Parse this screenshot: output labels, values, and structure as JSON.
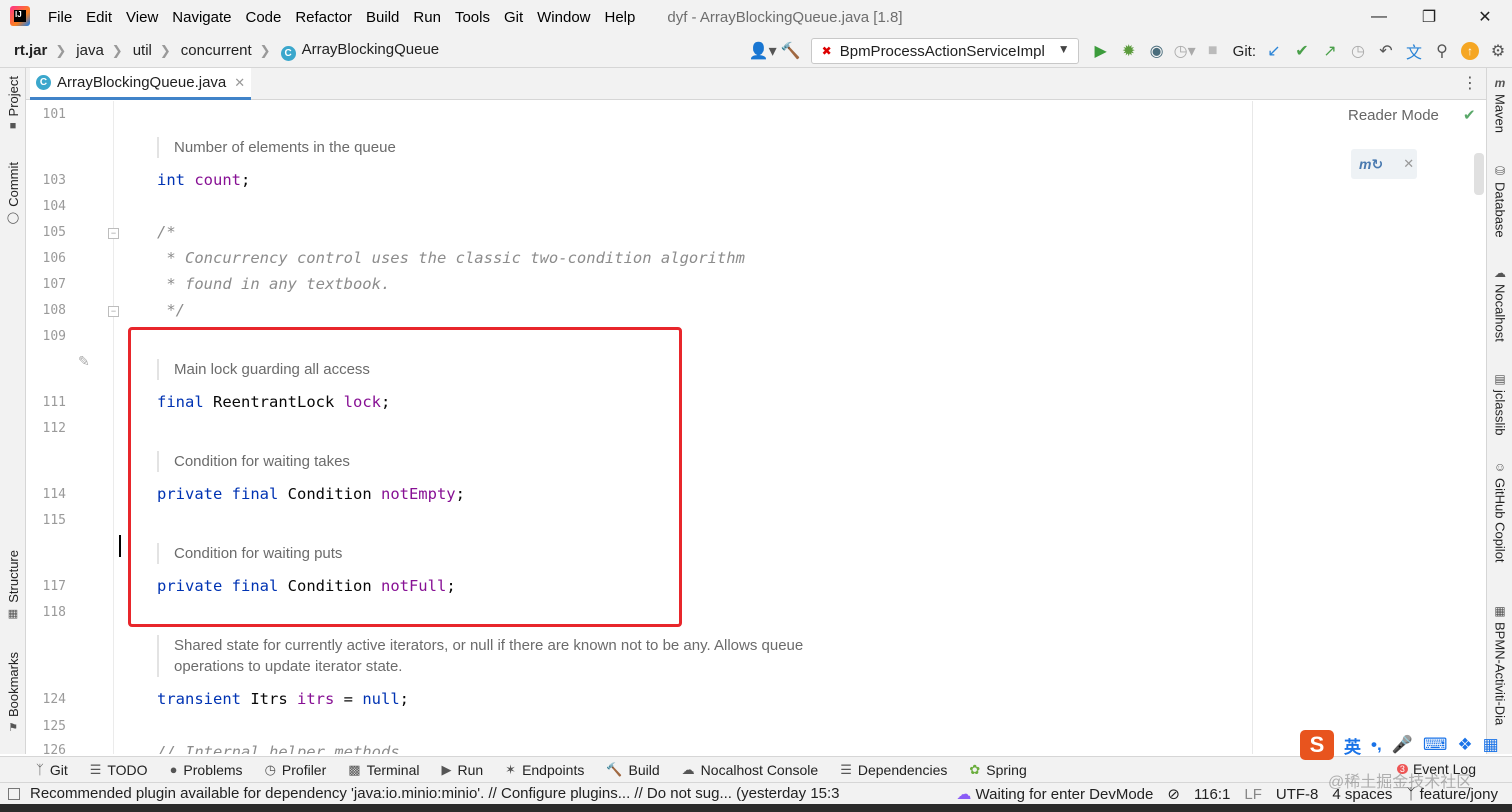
{
  "menubar": {
    "items": [
      "File",
      "Edit",
      "View",
      "Navigate",
      "Code",
      "Refactor",
      "Build",
      "Run",
      "Tools",
      "Git",
      "Window",
      "Help"
    ],
    "title": "dyf - ArrayBlockingQueue.java [1.8]"
  },
  "navbar": {
    "crumbs": [
      "rt.jar",
      "java",
      "util",
      "concurrent",
      "ArrayBlockingQueue"
    ],
    "run_config": "BpmProcessActionServiceImpl",
    "git_label": "Git:"
  },
  "tab": {
    "label": "ArrayBlockingQueue.java"
  },
  "left_tools": [
    "Project",
    "Commit",
    "Structure",
    "Bookmarks"
  ],
  "right_tools": [
    "Maven",
    "Database",
    "Nocalhost",
    "jclasslib",
    "GitHub Copilot",
    "BPMN-Activiti-Dia"
  ],
  "editor": {
    "reader_mode": "Reader Mode",
    "lines": [
      "101",
      "103",
      "104",
      "105",
      "106",
      "107",
      "108",
      "109",
      "111",
      "112",
      "114",
      "115",
      "117",
      "118",
      "124",
      "125",
      "126"
    ],
    "doc_count": "Number of elements in the queue",
    "code_count": {
      "kw": "int",
      "name": "count",
      "end": ";"
    },
    "comment_1": "/*",
    "comment_2": " * Concurrency control uses the classic two-condition algorithm",
    "comment_3": " * found in any textbook.",
    "comment_4": " */",
    "doc_lock": "Main lock guarding all access",
    "code_lock": {
      "kw": "final",
      "type": " ReentrantLock ",
      "name": "lock",
      "end": ";"
    },
    "doc_notempty": "Condition for waiting takes",
    "code_notempty": {
      "kw": "private final",
      "type": " Condition ",
      "name": "notEmpty",
      "end": ";"
    },
    "doc_notfull": "Condition for waiting puts",
    "code_notfull": {
      "kw": "private final",
      "type": " Condition ",
      "name": "notFull",
      "end": ";"
    },
    "doc_itrs_1": "Shared state for currently active iterators, or null if there are known not to be any. Allows queue",
    "doc_itrs_2": "operations to update iterator state.",
    "code_itrs": {
      "kw": "transient",
      "type": " Itrs ",
      "name": "itrs",
      "mid": " = ",
      "kw2": "null",
      "end": ";"
    },
    "code_last": "// Internal helper methods"
  },
  "toolwindows": [
    "Git",
    "TODO",
    "Problems",
    "Profiler",
    "Terminal",
    "Run",
    "Endpoints",
    "Build",
    "Nocalhost Console",
    "Dependencies",
    "Spring"
  ],
  "event_log": {
    "label": "Event Log",
    "count": "3"
  },
  "status": {
    "message": "Recommended plugin available for dependency 'java:io.minio:minio'. // Configure plugins... // Do not sug... (yesterday 15:3",
    "devmode": "Waiting for enter DevMode",
    "position": "116:1",
    "line_sep": "LF",
    "encoding": "UTF-8",
    "indent": "4 spaces",
    "branch": "feature/jony"
  },
  "ime": {
    "lang": "英"
  },
  "watermark": "@稀土掘金技术社区",
  "colors": {
    "highlight": "#e8262b",
    "keyword": "#0033b3",
    "field": "#871094"
  }
}
